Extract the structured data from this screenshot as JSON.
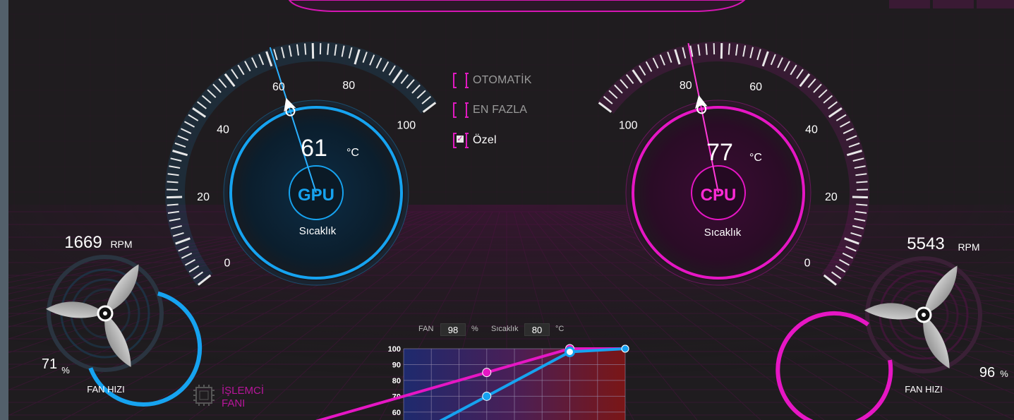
{
  "modes": [
    {
      "label": "OTOMATİK",
      "checked": false
    },
    {
      "label": "EN FAZLA",
      "checked": false
    },
    {
      "label": "Özel",
      "checked": true
    }
  ],
  "gpu": {
    "name": "GPU",
    "temp": "61",
    "temp_unit": "°C",
    "temp_label": "Sıcaklık",
    "dial_ticks": [
      "0",
      "20",
      "40",
      "60",
      "80",
      "100"
    ],
    "rpm": "1669",
    "rpm_unit": "RPM",
    "fan_percent": "71",
    "fan_percent_fraction": 0.71,
    "percent_unit": "%",
    "fan_label": "FAN HIZI",
    "color": "#16a3f0"
  },
  "cpu": {
    "name": "CPU",
    "temp": "77",
    "temp_unit": "°C",
    "temp_label": "Sıcaklık",
    "dial_ticks": [
      "0",
      "20",
      "40",
      "60",
      "80",
      "100"
    ],
    "rpm": "5543",
    "rpm_unit": "RPM",
    "fan_percent": "96",
    "fan_percent_fraction": 0.96,
    "percent_unit": "%",
    "fan_label": "FAN HIZI",
    "color": "#e616c4"
  },
  "processor_fan": {
    "label": "İŞLEMCİ FANI"
  },
  "curve_readout": {
    "fan_label": "FAN",
    "fan_value": "98",
    "fan_unit": "%",
    "temp_label": "Sıcaklık",
    "temp_value": "80",
    "temp_unit": "°C"
  },
  "chart_data": {
    "type": "line",
    "y_ticks": [
      "100",
      "90",
      "80",
      "70",
      "60"
    ],
    "ylim": [
      55,
      100
    ],
    "xlim": [
      20,
      100
    ],
    "series": [
      {
        "color": "#e616c4",
        "points": [
          [
            50,
            85
          ],
          [
            80,
            100
          ],
          [
            100,
            100
          ]
        ]
      },
      {
        "color": "#16a3f0",
        "points": [
          [
            50,
            70
          ],
          [
            80,
            98
          ],
          [
            100,
            100
          ]
        ]
      }
    ]
  }
}
